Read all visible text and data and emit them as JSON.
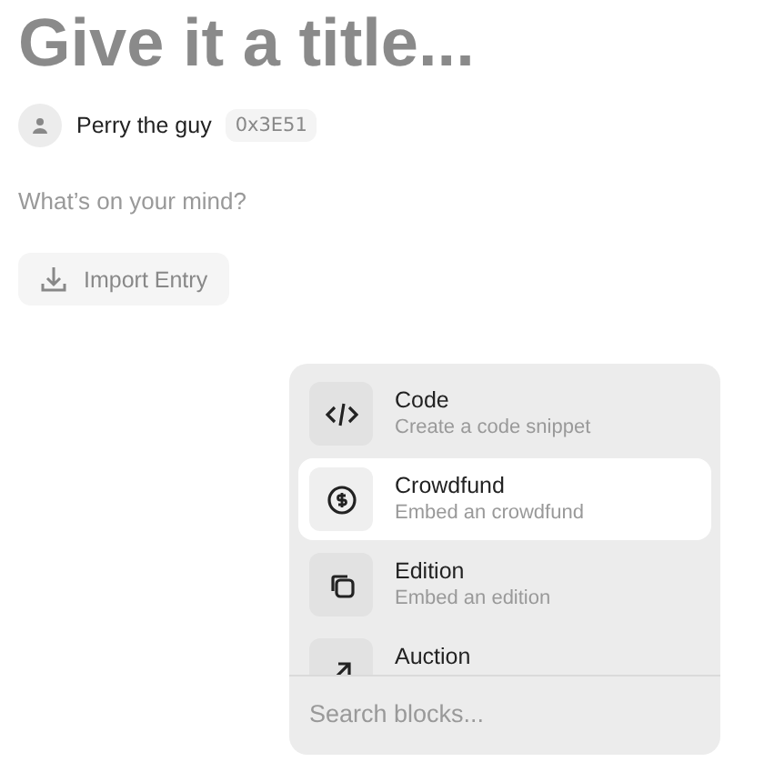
{
  "title_placeholder": "Give it a title...",
  "author": {
    "name": "Perry the guy",
    "address": "0x3E51"
  },
  "body_placeholder": "What’s on your mind?",
  "import_button": {
    "label": "Import Entry"
  },
  "block_menu": {
    "items": [
      {
        "kind": "code",
        "title": "Code",
        "description": "Create a code snippet",
        "selected": false
      },
      {
        "kind": "crowdfund",
        "title": "Crowdfund",
        "description": "Embed an crowdfund",
        "selected": true
      },
      {
        "kind": "edition",
        "title": "Edition",
        "description": "Embed an edition",
        "selected": false
      },
      {
        "kind": "auction",
        "title": "Auction",
        "selected": false
      }
    ],
    "search": {
      "placeholder": "Search blocks..."
    }
  }
}
